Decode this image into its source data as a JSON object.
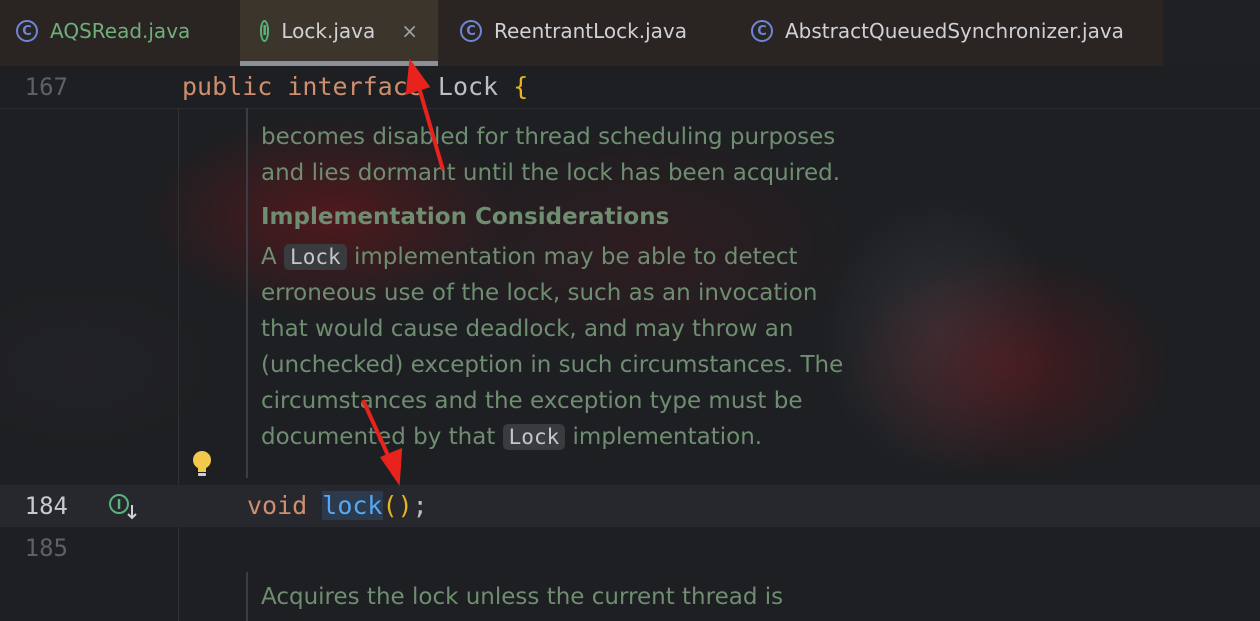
{
  "tabs": [
    {
      "label": "AQSRead.java",
      "icon": "class-run-icon",
      "active": false
    },
    {
      "label": "Lock.java",
      "icon": "interface-icon",
      "active": true,
      "close": "×"
    },
    {
      "label": "ReentrantLock.java",
      "icon": "class-icon",
      "active": false
    },
    {
      "label": "AbstractQueuedSynchronizer.java",
      "icon": "class-icon",
      "active": false
    }
  ],
  "editor": {
    "header_line": {
      "number": "167",
      "kw1": "public",
      "kw2": "interface",
      "name": "Lock",
      "brace": "{"
    },
    "doc_top": [
      "becomes disabled for thread scheduling purposes",
      "and lies dormant until the lock has been acquired."
    ],
    "doc_heading": "Implementation Considerations",
    "doc_body": {
      "l1_pre": "A",
      "l1_code": "Lock",
      "l1_post": "implementation may be able to detect",
      "l2": "erroneous use of the lock, such as an invocation",
      "l3": "that would cause deadlock, and may throw an",
      "l4": "(unchecked) exception in such circumstances. The",
      "l5": "circumstances and the exception type must be",
      "l6_pre": "documented by that",
      "l6_code": "Lock",
      "l6_post": "implementation."
    },
    "current_line": {
      "number": "184",
      "kw": "void",
      "method": "lock",
      "open": "(",
      "close": ")",
      "semi": ";"
    },
    "line_185": "185",
    "doc_bottom": "Acquires the lock unless the current thread is"
  },
  "colors": {
    "keyword": "#cf8e6d",
    "method": "#56a8f5",
    "doc": "#6f8d70",
    "annotation_arrow": "#e8231e"
  }
}
